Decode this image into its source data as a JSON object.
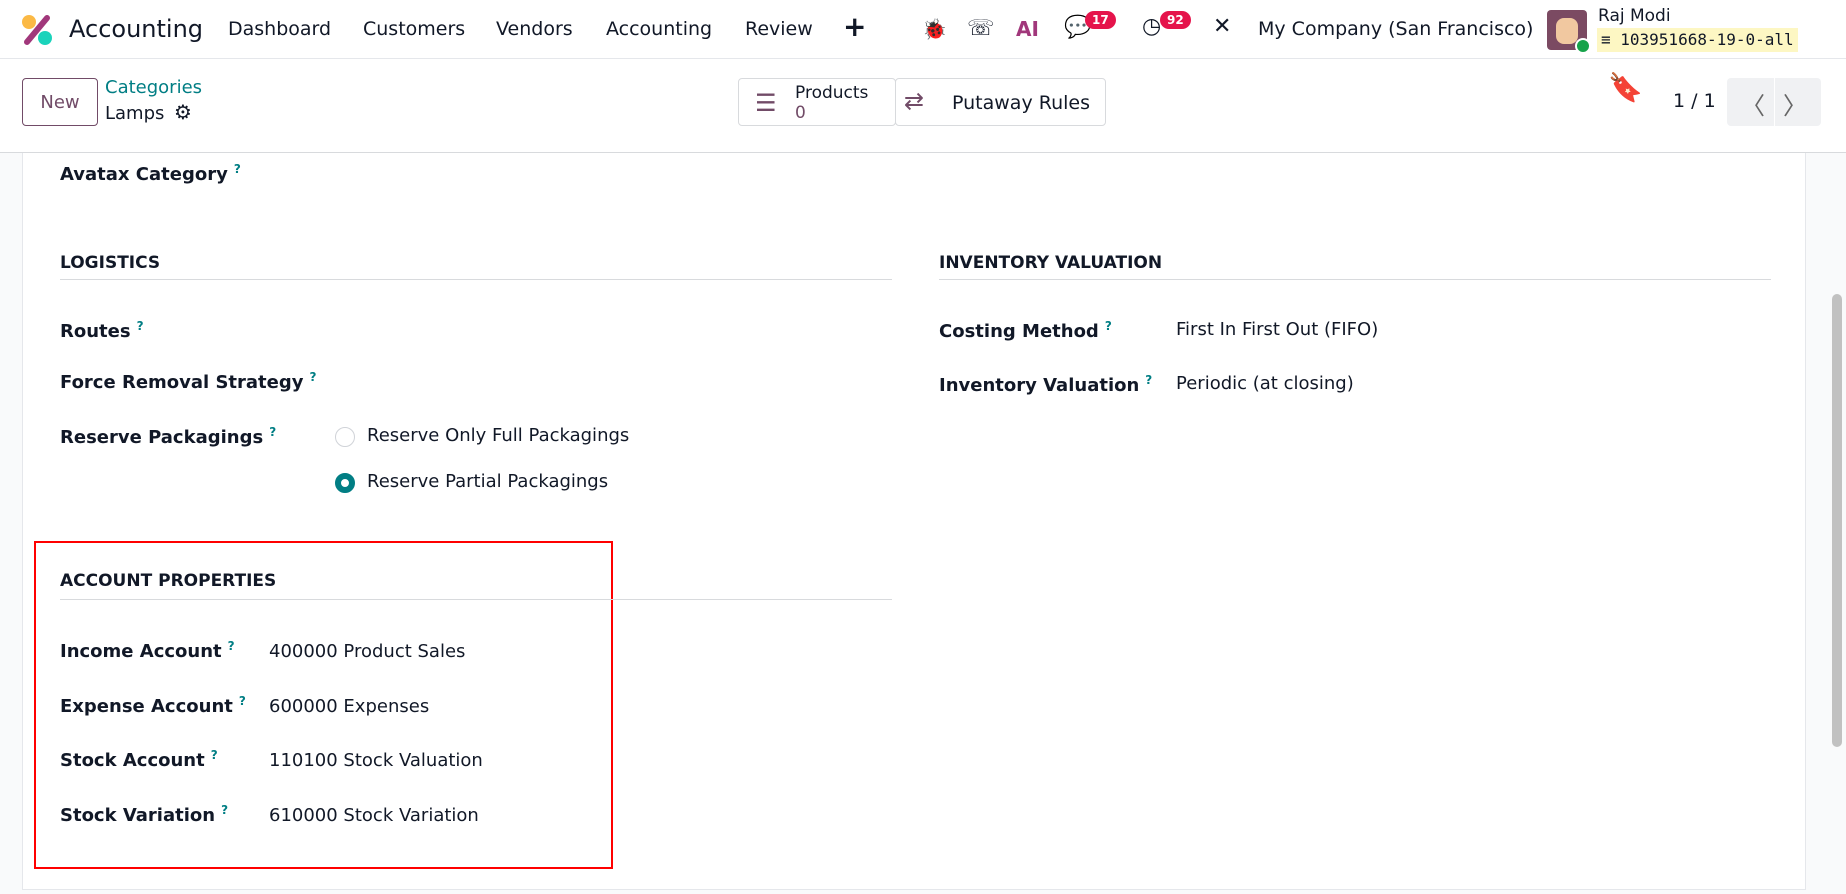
{
  "navbar": {
    "app_name": "Accounting",
    "menu": [
      "Dashboard",
      "Customers",
      "Vendors",
      "Accounting",
      "Review"
    ],
    "plus": "+",
    "chat_count": "17",
    "activity_count": "92",
    "ai_label": "AI",
    "company": "My Company (San Francisco)",
    "user_name": "Raj Modi",
    "database": "103951668-19-0-all"
  },
  "control": {
    "new_label": "New",
    "breadcrumb_parent": "Categories",
    "record_name": "Lamps",
    "products_label": "Products",
    "products_count": "0",
    "putaway_label": "Putaway Rules",
    "pager": "1 / 1"
  },
  "form": {
    "avatax_label": "Avatax Category",
    "logistics": {
      "title": "LOGISTICS",
      "routes": "Routes",
      "force_removal": "Force Removal Strategy",
      "reserve_packagings": "Reserve Packagings",
      "options": [
        "Reserve Only Full Packagings",
        "Reserve Partial Packagings"
      ],
      "selected": 1
    },
    "inventory": {
      "title": "INVENTORY VALUATION",
      "costing_label": "Costing Method",
      "costing_value": "First In First Out (FIFO)",
      "valuation_label": "Inventory Valuation",
      "valuation_value": "Periodic (at closing)"
    },
    "accounts": {
      "title": "ACCOUNT PROPERTIES",
      "rows": [
        {
          "label": "Income Account",
          "value": "400000 Product Sales"
        },
        {
          "label": "Expense Account",
          "value": "600000 Expenses"
        },
        {
          "label": "Stock Account",
          "value": "110100 Stock Valuation"
        },
        {
          "label": "Stock Variation",
          "value": "610000 Stock Variation"
        }
      ]
    },
    "help_mark": "?"
  },
  "colors": {
    "brand": "#714b67",
    "teal": "#017e84",
    "badge": "#e5134b",
    "highlight": "#ff0000"
  }
}
